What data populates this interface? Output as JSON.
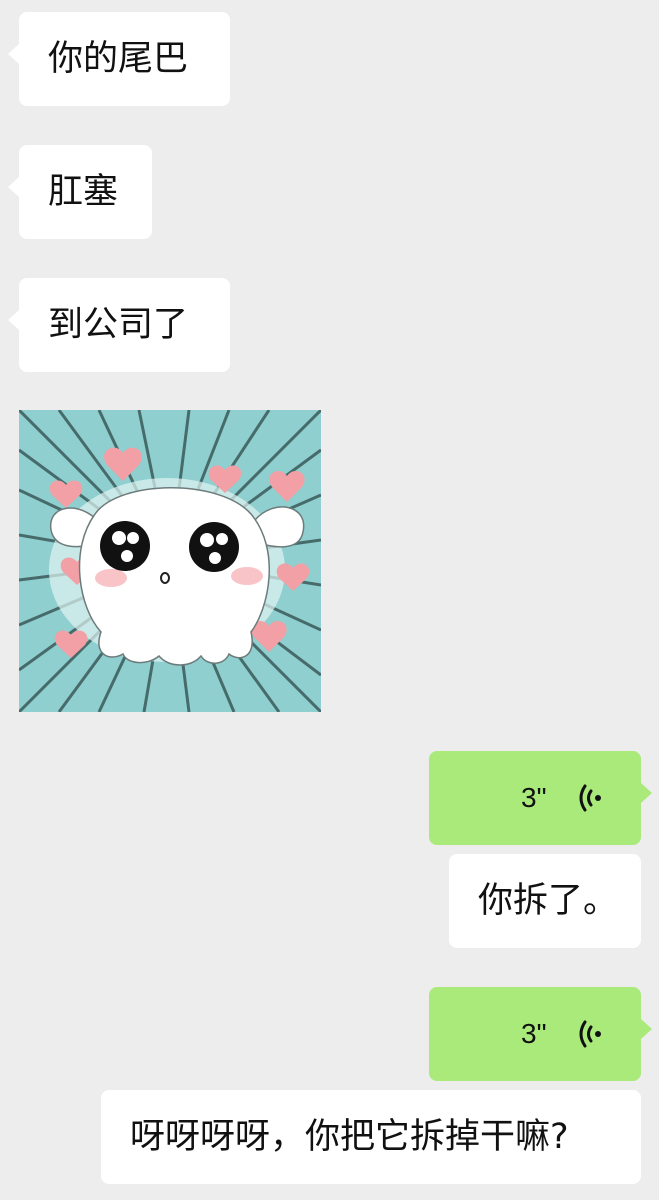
{
  "messages": [
    {
      "side": "left",
      "type": "text",
      "text": "你的尾巴"
    },
    {
      "side": "left",
      "type": "text",
      "text": "肛塞"
    },
    {
      "side": "left",
      "type": "text",
      "text": "到公司了"
    },
    {
      "side": "left",
      "type": "sticker",
      "icon": "cute-cat-sticker"
    },
    {
      "side": "right",
      "type": "voice",
      "duration": "3\"",
      "icon": "voice-wave-icon"
    },
    {
      "side": "right",
      "type": "text",
      "text": "你拆了。"
    },
    {
      "side": "right",
      "type": "voice",
      "duration": "3\"",
      "icon": "voice-wave-icon"
    },
    {
      "side": "right",
      "type": "text",
      "text": "呀呀呀呀，你把它拆掉干嘛?"
    }
  ],
  "colors": {
    "background": "#ededed",
    "incoming_bubble": "#ffffff",
    "voice_bubble": "#a9ea7a",
    "text": "#111111"
  }
}
